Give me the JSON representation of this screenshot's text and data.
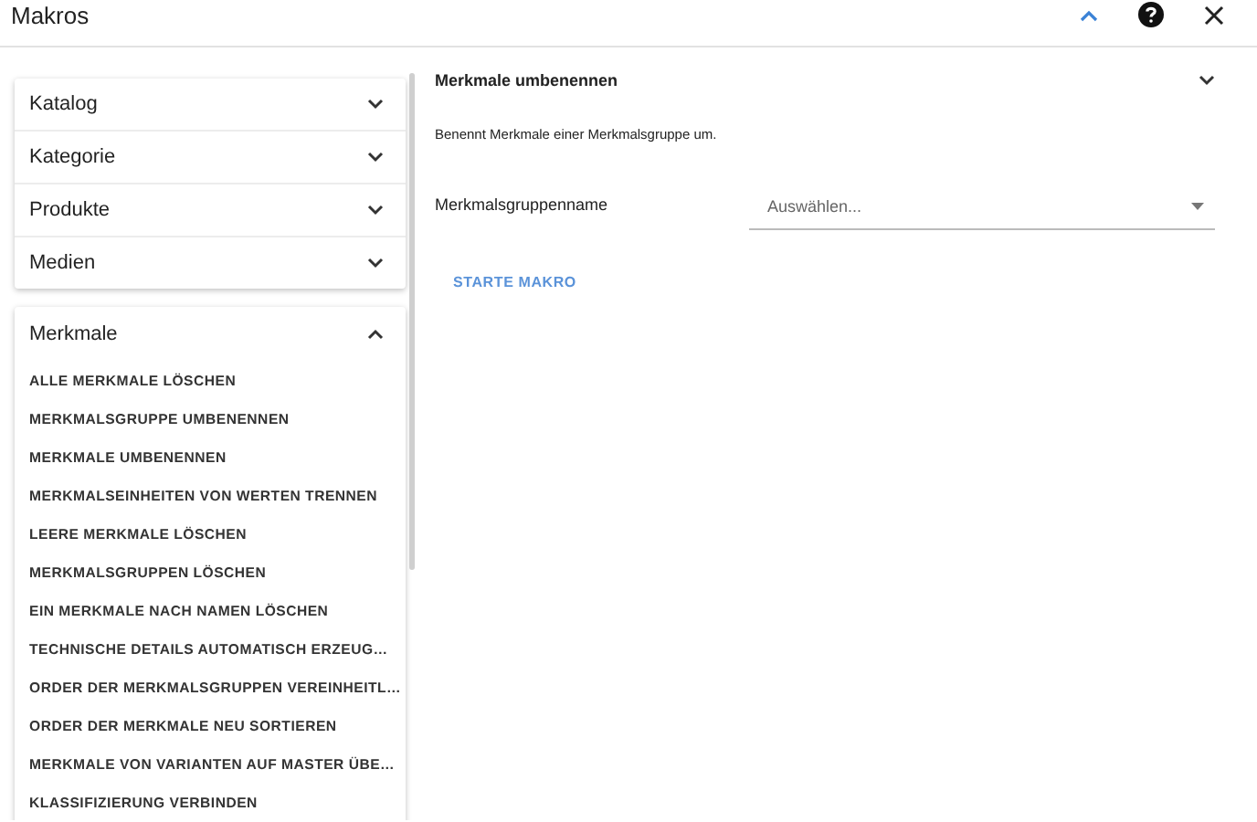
{
  "window": {
    "title": "Makros"
  },
  "sections": [
    {
      "label": "Katalog",
      "expanded": false
    },
    {
      "label": "Kategorie",
      "expanded": false
    },
    {
      "label": "Produkte",
      "expanded": false
    },
    {
      "label": "Medien",
      "expanded": false
    }
  ],
  "merkmale": {
    "label": "Merkmale",
    "expanded": true,
    "items": [
      {
        "label": "ALLE MERKMALE LÖSCHEN",
        "selected": false
      },
      {
        "label": "MERKMALSGRUPPE UMBENENNEN",
        "selected": false
      },
      {
        "label": "MERKMALE UMBENENNEN",
        "selected": false
      },
      {
        "label": "MERKMALSEINHEITEN VON WERTEN TRENNEN",
        "selected": false
      },
      {
        "label": "LEERE MERKMALE LÖSCHEN",
        "selected": false
      },
      {
        "label": "MERKMALSGRUPPEN LÖSCHEN",
        "selected": false
      },
      {
        "label": "EIN MERKMALE NACH NAMEN LÖSCHEN",
        "selected": false
      },
      {
        "label": "TECHNISCHE DETAILS AUTOMATISCH ERZEUG…",
        "selected": false
      },
      {
        "label": "ORDER DER MERKMALSGRUPPEN VEREINHEITL…",
        "selected": false
      },
      {
        "label": "ORDER DER MERKMALE NEU SORTIEREN",
        "selected": false
      },
      {
        "label": "MERKMALE VON VARIANTEN AUF MASTER ÜBE…",
        "selected": false
      },
      {
        "label": "KLASSIFIZIERUNG VERBINDEN",
        "selected": false
      }
    ]
  },
  "detail": {
    "title": "Merkmale umbenennen",
    "description": "Benennt Merkmale einer Merkmalsgruppe um.",
    "field_label": "Merkmalsgruppenname",
    "placeholder": "Auswählen...",
    "button": "STARTE MAKRO"
  }
}
